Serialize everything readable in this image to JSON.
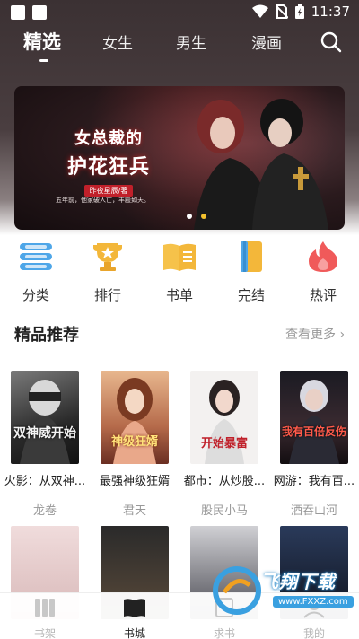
{
  "status_bar": {
    "time": "11:37"
  },
  "nav": {
    "tabs": [
      {
        "label": "精选",
        "active": true
      },
      {
        "label": "女生",
        "active": false
      },
      {
        "label": "男生",
        "active": false
      },
      {
        "label": "漫画",
        "active": false
      }
    ],
    "search_icon": "search-icon"
  },
  "banner": {
    "title_line1": "女总裁的",
    "title_line2": "护花狂兵",
    "author": "昨夜星辰/著",
    "tagline": "五年前，他家破人亡，丰殿如天。",
    "active_dot": 2,
    "dot_count": 2
  },
  "categories": [
    {
      "label": "分类",
      "icon": "category-list-icon"
    },
    {
      "label": "排行",
      "icon": "trophy-icon"
    },
    {
      "label": "书单",
      "icon": "open-book-icon"
    },
    {
      "label": "完结",
      "icon": "notebook-icon"
    },
    {
      "label": "热评",
      "icon": "flame-icon"
    }
  ],
  "section": {
    "title": "精品推荐",
    "see_more": "查看更多 ›"
  },
  "books": [
    {
      "title": "火影：从双神...",
      "author": "龙卷",
      "cover_text": "双神威开始"
    },
    {
      "title": "最强神级狂婿",
      "author": "君天",
      "cover_text": "神级狂婿"
    },
    {
      "title": "都市：从炒股...",
      "author": "股民小马",
      "cover_text": "开始暴富"
    },
    {
      "title": "网游：我有百...",
      "author": "酒吞山河",
      "cover_text": "我有百倍反伤"
    }
  ],
  "bottom_nav": [
    {
      "label": "书架",
      "icon": "bookshelf-icon",
      "active": false
    },
    {
      "label": "书城",
      "icon": "book-city-icon",
      "active": true
    },
    {
      "label": "求书",
      "icon": "request-book-icon",
      "active": false
    },
    {
      "label": "我的",
      "icon": "profile-icon",
      "active": false
    }
  ],
  "watermark": {
    "text": "飞翔下载",
    "url": "www.FXXZ.com"
  },
  "colors": {
    "header_bg": "#3b3133",
    "dot_active": "#f3c12e",
    "muted_text": "#999999"
  }
}
